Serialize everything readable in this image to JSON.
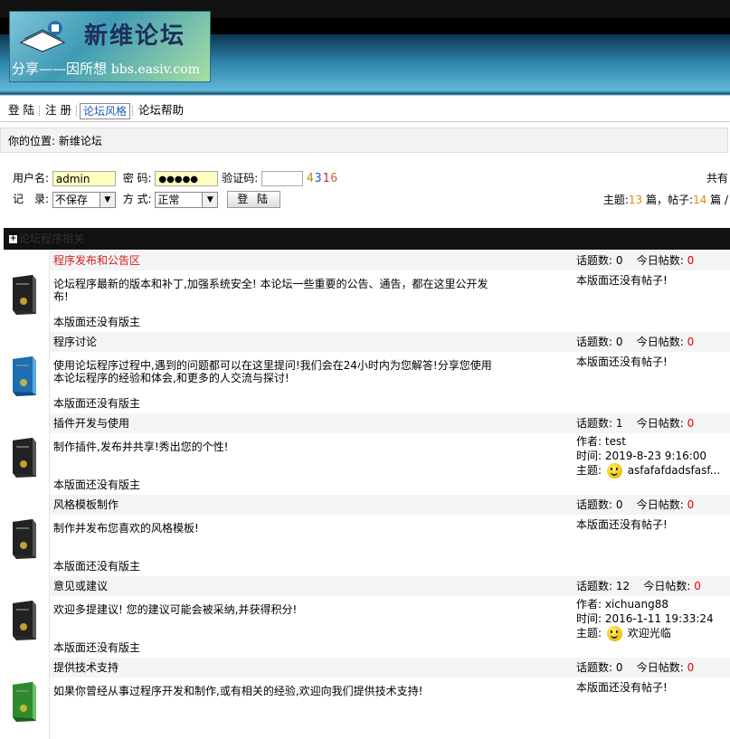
{
  "logo": {
    "title": "新维论坛",
    "slogan": "分享——因所想",
    "domain": "bbs.easiv.com"
  },
  "nav": {
    "items": [
      "登 陆",
      "注 册",
      "论坛风格",
      "论坛帮助"
    ]
  },
  "breadcrumb": {
    "label": "你的位置:",
    "value": "新维论坛"
  },
  "login": {
    "username_label": "用户名:",
    "username_value": "admin",
    "password_label": "密 码:",
    "password_value": "●●●●●",
    "captcha_label": "验证码:",
    "captcha_code": "4316",
    "record_label": "记　录:",
    "record_value": "不保存",
    "mode_label": "方 式:",
    "mode_value": "正常",
    "submit_label": "登 陆"
  },
  "stats": {
    "line1": "共有",
    "topics_label": "主题:",
    "topics": "13",
    "topics_unit": " 篇，帖子:",
    "posts": "14",
    "posts_unit": " 篇 /"
  },
  "category": {
    "title": "论坛程序相关"
  },
  "colors": {
    "accent_red": "#d02020",
    "count_orange": "#e8860c",
    "zero_red": "#e00000"
  },
  "forums": [
    {
      "name": "程序发布和公告区",
      "topics_label": "话题数:",
      "topics": "0",
      "today_label": "今日帖数:",
      "today": "0",
      "desc": "论坛程序最新的版本和补丁,加强系统安全! 本论坛一些重要的公告、通告，都在这里公开发布!",
      "mod": "本版面还没有版主",
      "last": "本版面还没有帖子!",
      "icon": "box-dark-icon"
    },
    {
      "name": "程序讨论",
      "topics_label": "话题数:",
      "topics": "0",
      "today_label": "今日帖数:",
      "today": "0",
      "desc": "使用论坛程序过程中,遇到的问题都可以在这里提问!我们会在24小时内为您解答!分享您使用本论坛程序的经验和体会,和更多的人交流与探讨!",
      "mod": "本版面还没有版主",
      "last": "本版面还没有帖子!",
      "icon": "box-blue-icon"
    },
    {
      "name": "插件开发与使用",
      "topics_label": "话题数:",
      "topics": "1",
      "today_label": "今日帖数:",
      "today": "0",
      "desc": "制作插件,发布并共享!秀出您的个性!",
      "mod": "本版面还没有版主",
      "author_label": "作者:",
      "author": "test",
      "time_label": "时间:",
      "time": "2019-8-23 9:16:00",
      "subject_label": "主题:",
      "subject": "asfafafdadsfasf...",
      "icon": "box-dark-icon"
    },
    {
      "name": "风格模板制作",
      "topics_label": "话题数:",
      "topics": "0",
      "today_label": "今日帖数:",
      "today": "0",
      "desc": "制作并发布您喜欢的风格模板!",
      "mod": "本版面还没有版主",
      "last": "本版面还没有帖子!",
      "icon": "box-dark-icon"
    },
    {
      "name": "意见或建议",
      "topics_label": "话题数:",
      "topics": "12",
      "today_label": "今日帖数:",
      "today": "0",
      "desc": "欢迎多提建议! 您的建议可能会被采纳,并获得积分!",
      "mod": "本版面还没有版主",
      "author_label": "作者:",
      "author": "xichuang88",
      "time_label": "时间:",
      "time": "2016-1-11 19:33:24",
      "subject_label": "主题:",
      "subject": "欢迎光临",
      "icon": "box-dark-icon"
    },
    {
      "name": "提供技术支持",
      "topics_label": "话题数:",
      "topics": "0",
      "today_label": "今日帖数:",
      "today": "0",
      "desc": "如果你曾经从事过程序开发和制作,或有相关的经验,欢迎向我们提供技术支持!",
      "mod": "",
      "last": "本版面还没有帖子!",
      "icon": "box-green-icon"
    }
  ]
}
